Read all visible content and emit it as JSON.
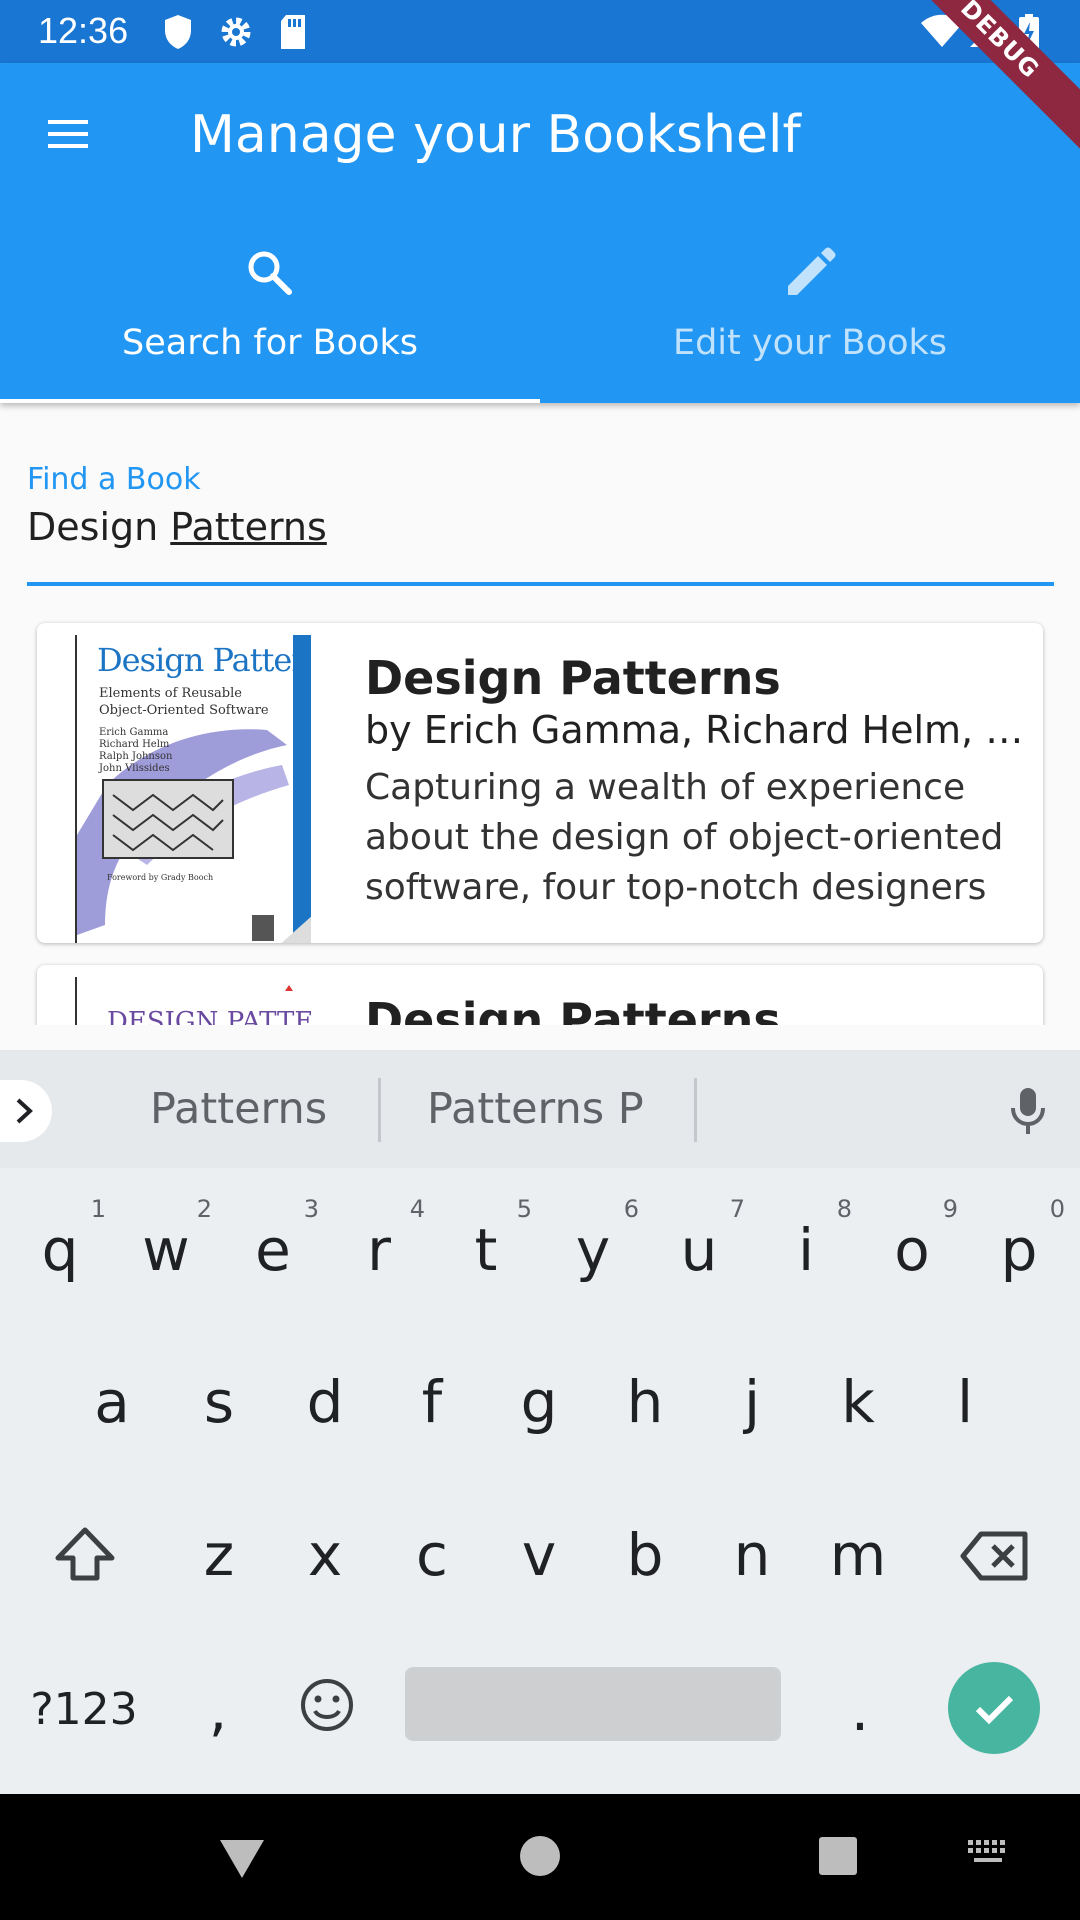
{
  "status_bar": {
    "time": "12:36",
    "icons": [
      "shield-icon",
      "gear-icon",
      "sd-card-icon",
      "wifi-icon",
      "signal-icon",
      "battery-charging-icon"
    ]
  },
  "debug_banner": "DEBUG",
  "app_bar": {
    "title": "Manage your Bookshelf",
    "menu_icon": "menu-icon",
    "tabs": [
      {
        "label": "Search for Books",
        "icon": "search-icon",
        "selected": true
      },
      {
        "label": "Edit your Books",
        "icon": "pencil-icon",
        "selected": false
      }
    ]
  },
  "search": {
    "label": "Find a Book",
    "value_plain": "Design ",
    "value_composing": "Patterns"
  },
  "results": [
    {
      "title": "Design Patterns",
      "authors": "by Erich Gamma, Richard Helm, Ralph Johnson, John Vlissides",
      "description": "Capturing a wealth of experience about the design of object-oriented software, four top-notch designers present a catalog of simple and succinct solutions",
      "cover": {
        "title": "Design Patterns",
        "subtitle": "Elements of Reusable Object-Oriented Software",
        "authors": [
          "Erich Gamma",
          "Richard Helm",
          "Ralph Johnson",
          "John Vlissides"
        ],
        "foreword": "Foreword by Grady Booch"
      }
    },
    {
      "title": "Design Patterns ...",
      "cover": {
        "title": "DESIGN PATTERNS"
      }
    }
  ],
  "keyboard": {
    "suggestions": [
      "Patterns",
      "Patterns P"
    ],
    "row1": [
      {
        "key": "q",
        "hint": "1"
      },
      {
        "key": "w",
        "hint": "2"
      },
      {
        "key": "e",
        "hint": "3"
      },
      {
        "key": "r",
        "hint": "4"
      },
      {
        "key": "t",
        "hint": "5"
      },
      {
        "key": "y",
        "hint": "6"
      },
      {
        "key": "u",
        "hint": "7"
      },
      {
        "key": "i",
        "hint": "8"
      },
      {
        "key": "o",
        "hint": "9"
      },
      {
        "key": "p",
        "hint": "0"
      }
    ],
    "row2": [
      "a",
      "s",
      "d",
      "f",
      "g",
      "h",
      "j",
      "k",
      "l"
    ],
    "row3": [
      "z",
      "x",
      "c",
      "v",
      "b",
      "n",
      "m"
    ],
    "symbols_key": "?123",
    "comma_key": ",",
    "period_key": ".",
    "accent_color": "#48b5a0"
  },
  "colors": {
    "primary": "#2196f3",
    "primary_dark": "#1976d2",
    "debug": "#8e2740"
  }
}
